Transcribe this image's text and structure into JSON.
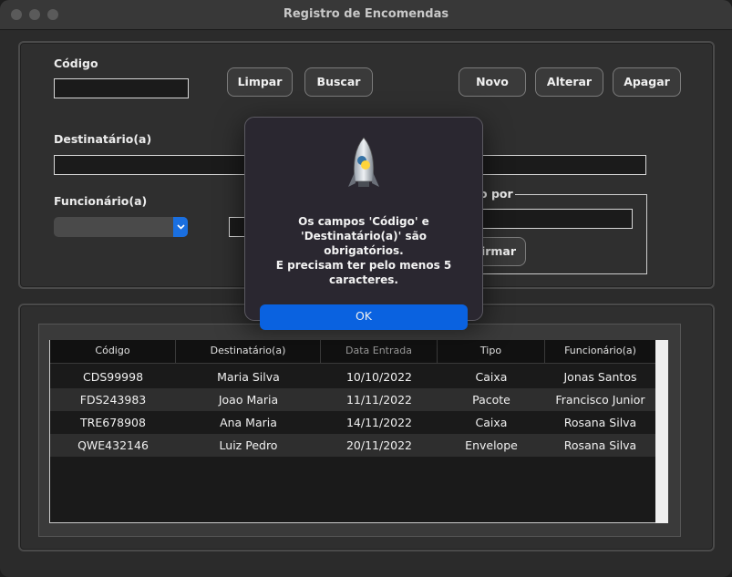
{
  "window": {
    "title": "Registro de Encomendas"
  },
  "form": {
    "codigo_label": "Código",
    "codigo_value": "",
    "destinatario_label": "Destinatário(a)",
    "destinatario_value": "",
    "funcionario_label": "Funcionário(a)",
    "funcionario_selected": "",
    "group_title_partial": "o por",
    "group_field_value": "",
    "confirm_button_partial": "firmar",
    "buttons": {
      "limpar": "Limpar",
      "buscar": "Buscar",
      "novo": "Novo",
      "alterar": "Alterar",
      "apagar": "Apagar"
    }
  },
  "table": {
    "columns": [
      "Código",
      "Destinatário(a)",
      "Data Entrada",
      "Tipo",
      "Funcionário(a)"
    ],
    "rows": [
      [
        "CDS99998",
        "Maria Silva",
        "10/10/2022",
        "Caixa",
        "Jonas Santos"
      ],
      [
        "FDS243983",
        "Joao Maria",
        "11/11/2022",
        "Pacote",
        "Francisco Junior"
      ],
      [
        "TRE678908",
        "Ana Maria",
        "14/11/2022",
        "Caixa",
        "Rosana Silva"
      ],
      [
        "QWE432146",
        "Luiz Pedro",
        "20/11/2022",
        "Envelope",
        "Rosana Silva"
      ]
    ]
  },
  "dialog": {
    "message": "Os campos 'Código' e\n'Destinatário(a)' são\nobrigatórios.\nE precisam ter pelo menos 5\ncaracteres.",
    "ok_label": "OK",
    "icon": "python-rocket-icon"
  },
  "colors": {
    "accent": "#1a6fe0",
    "window_bg": "#2b2b2b",
    "row_alt": "#2e2e2e"
  }
}
